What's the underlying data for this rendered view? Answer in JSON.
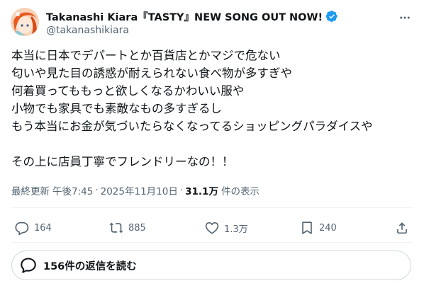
{
  "author": {
    "display_name": "Takanashi Kiara『TASTY』NEW SONG OUT NOW!",
    "handle": "@takanashikiara",
    "verified": true
  },
  "tweet": {
    "lines": [
      "本当に日本でデパートとか百貨店とかマジで危ない",
      "匂いや見た目の誘惑が耐えられない食べ物が多すぎや",
      "何着買ってももっと欲しくなるかわいい服や",
      "小物でも家具でも素敵なもの多すぎるし",
      "もう本当にお金が気づいたらなくなってるショッピングパラダイスや",
      "",
      "その上に店員丁寧でフレンドリーなの！！"
    ]
  },
  "meta": {
    "edited_label": "最終更新",
    "time": "午後7:45",
    "separator": "·",
    "date": "2025年11月10日",
    "views_count": "31.1万",
    "views_label": "件の表示"
  },
  "actions": {
    "replies": "164",
    "reposts": "885",
    "likes": "1.3万",
    "bookmarks": "240"
  },
  "replies_button": {
    "label": "156件の返信を読む"
  },
  "colors": {
    "text": "#0f1419",
    "secondary": "#536471",
    "verified_blue": "#1d9bf0",
    "border": "#cfd9de",
    "divider": "#eff3f4"
  },
  "icons": {
    "more": "more-dots-icon",
    "verified": "verified-badge-icon",
    "reply": "reply-bubble-icon",
    "repost": "repost-arrows-icon",
    "like": "heart-icon",
    "bookmark": "bookmark-icon",
    "share": "share-upload-icon",
    "replies": "chat-bubble-icon"
  }
}
